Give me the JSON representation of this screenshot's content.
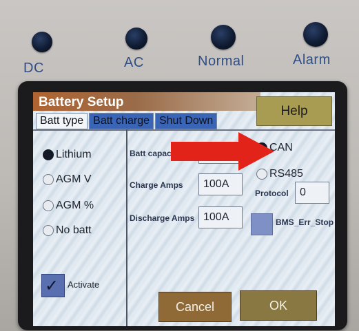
{
  "indicators": {
    "dc_label": "DC",
    "ac_label": "AC",
    "normal_label": "Normal",
    "alarm_label": "Alarm"
  },
  "dialog": {
    "title": "Battery Setup",
    "help_label": "Help",
    "tabs": [
      {
        "label": "Batt type",
        "active": true
      },
      {
        "label": "Batt charge",
        "active": false
      },
      {
        "label": "Shut Down",
        "active": false
      }
    ],
    "batt_types": [
      {
        "label": "Lithium",
        "checked": true
      },
      {
        "label": "AGM V",
        "checked": false
      },
      {
        "label": "AGM %",
        "checked": false
      },
      {
        "label": "No batt",
        "checked": false
      }
    ],
    "activate_label": "Activate",
    "activate_checked": true,
    "batt_capacity_label": "Batt capaci",
    "batt_capacity_value": "",
    "charge_amps_label": "Charge Amps",
    "charge_amps_value": "100A",
    "discharge_amps_label": "Discharge Amps",
    "discharge_amps_value": "100A",
    "comm_options": [
      {
        "label": "CAN",
        "checked": true
      },
      {
        "label": "RS485",
        "checked": false
      }
    ],
    "protocol_label": "Protocol",
    "protocol_value": "0",
    "bms_label": "BMS_Err_Stop",
    "bms_checked": false,
    "cancel_label": "Cancel",
    "ok_label": "OK"
  },
  "colors": {
    "led": "#101c33",
    "led_text": "#2f4e86",
    "arrow": "#e2231a",
    "title_bar": "#b06431",
    "tab_inactive": "#3a64b5",
    "help_button": "#a89b52",
    "cancel_button": "#8f6a36",
    "ok_button": "#8a7842"
  }
}
